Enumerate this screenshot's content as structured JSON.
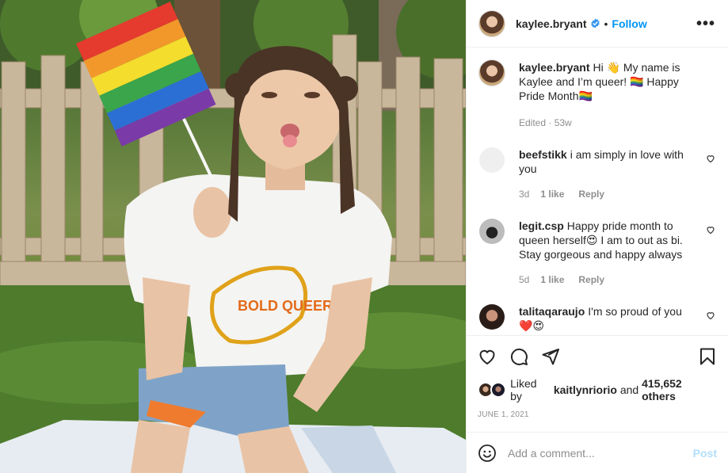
{
  "post": {
    "author": "kaylee.bryant",
    "follow_label": "Follow",
    "more_label": "•••",
    "caption": "Hi 👋 My name is Kaylee and I’m queer! 🏳️‍🌈 Happy Pride Month🏳️‍🌈",
    "caption_meta": "Edited · 53w"
  },
  "photo": {
    "shirt_text": "BOLD QUEER"
  },
  "comments": [
    {
      "user": "beefstikk",
      "text": "i am simply in love with you",
      "age": "3d",
      "likes": "1 like",
      "reply": "Reply"
    },
    {
      "user": "legit.csp",
      "text": "Happy pride month to queen herself😍 I am to out as bi. Stay gorgeous and happy always",
      "age": "5d",
      "likes": "1 like",
      "reply": "Reply"
    },
    {
      "user": "talitaqaraujo",
      "text": "I'm so proud of you ❤️😍"
    }
  ],
  "footer": {
    "liked_prefix": "Liked by",
    "liked_user": "kaitlynriorio",
    "liked_and": "and",
    "liked_count": "415,652 others",
    "date": "JUNE 1, 2021",
    "comment_placeholder": "Add a comment...",
    "post_label": "Post"
  },
  "icons": {
    "like": "heart-icon",
    "comment": "comment-icon",
    "share": "paper-plane-icon",
    "save": "bookmark-icon",
    "emoji": "smiley-icon",
    "verified": "verified-badge-icon"
  },
  "colors": {
    "accent": "#0095f6",
    "muted": "#8e8e8e",
    "heart_red": "#ed4956"
  }
}
